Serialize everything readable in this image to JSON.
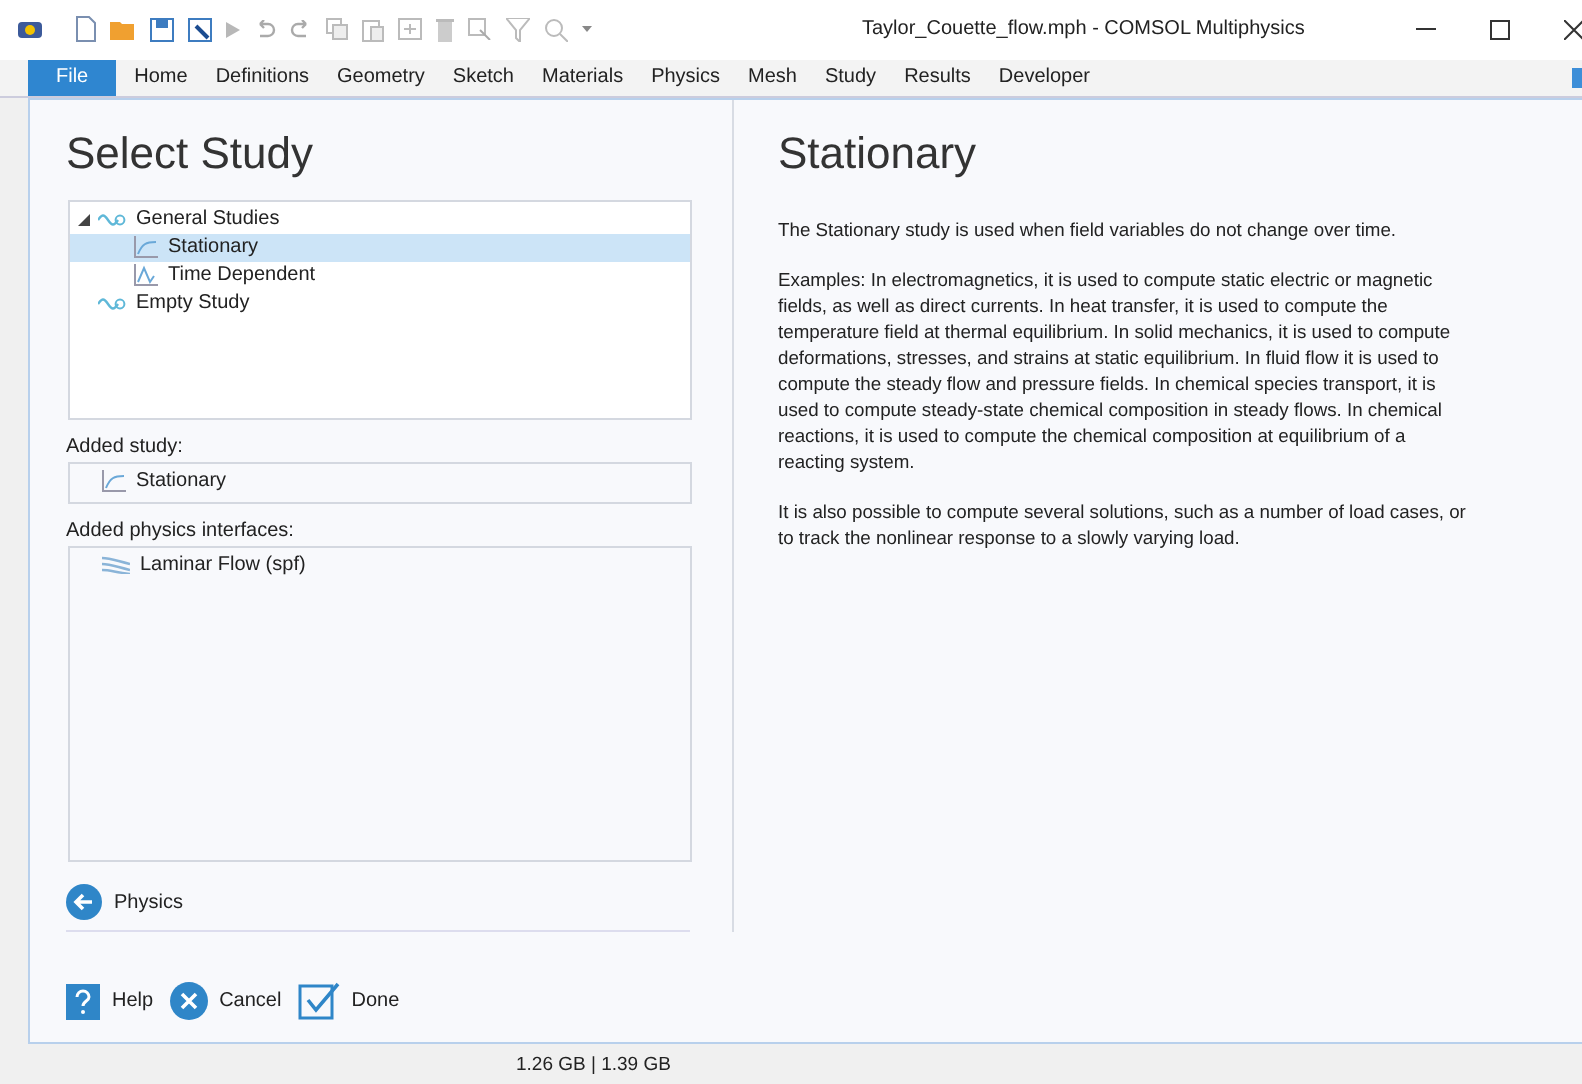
{
  "window": {
    "title": "Taylor_Couette_flow.mph - COMSOL Multiphysics"
  },
  "menu": [
    {
      "label": "File",
      "selected": true
    },
    {
      "label": "Home",
      "selected": false
    },
    {
      "label": "Definitions",
      "selected": false
    },
    {
      "label": "Geometry",
      "selected": false
    },
    {
      "label": "Sketch",
      "selected": false
    },
    {
      "label": "Materials",
      "selected": false
    },
    {
      "label": "Physics",
      "selected": false
    },
    {
      "label": "Mesh",
      "selected": false
    },
    {
      "label": "Study",
      "selected": false
    },
    {
      "label": "Results",
      "selected": false
    },
    {
      "label": "Developer",
      "selected": false
    }
  ],
  "select_study": {
    "title": "Select Study",
    "tree": [
      {
        "label": "General Studies",
        "kind": "group",
        "selected": false,
        "expanded": true,
        "children": [
          {
            "label": "Stationary",
            "kind": "stationary",
            "selected": true
          },
          {
            "label": "Time Dependent",
            "kind": "time",
            "selected": false
          }
        ]
      },
      {
        "label": "Empty Study",
        "kind": "group",
        "selected": false
      }
    ],
    "added_study_label": "Added study:",
    "added_study": [
      {
        "label": "Stationary",
        "kind": "stationary"
      }
    ],
    "added_physics_label": "Added physics interfaces:",
    "added_physics": [
      {
        "label": "Laminar Flow (spf)",
        "kind": "flow"
      }
    ],
    "back_button": "Physics",
    "buttons": [
      {
        "kind": "help",
        "label": "Help"
      },
      {
        "kind": "cancel",
        "label": "Cancel"
      },
      {
        "kind": "done",
        "label": "Done"
      }
    ]
  },
  "description": {
    "title": "Stationary",
    "paragraphs": [
      "The Stationary study is used when field variables do not change over time.",
      "Examples: In electromagnetics, it is used to compute static electric or magnetic fields, as well as direct currents. In heat transfer, it is used to compute the temperature field at thermal equilibrium. In solid mechanics, it is used to compute deformations, stresses, and strains at static equilibrium. In fluid flow it is used to compute the steady flow and pressure fields. In chemical species transport, it is used to compute steady-state chemical composition in steady flows. In chemical reactions, it is used to compute the chemical composition at equilibrium of a reacting system.",
      "It is also possible to compute several solutions, such as a number of load cases, or to track the nonlinear response to a slowly varying load."
    ]
  },
  "status_bar": "1.26 GB | 1.39 GB"
}
